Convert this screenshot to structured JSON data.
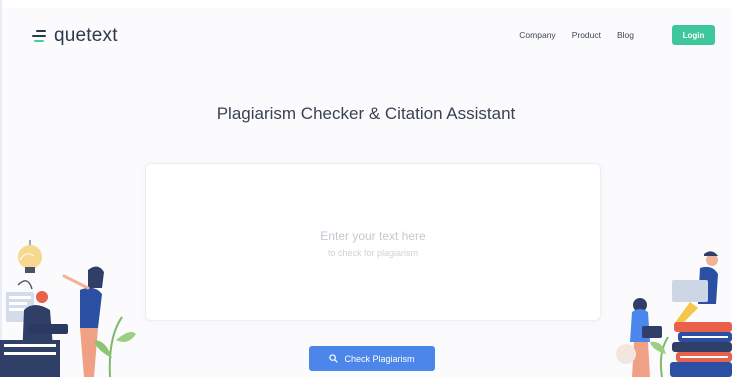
{
  "header": {
    "logo_text": "quetext",
    "nav": [
      "Company",
      "Product",
      "Blog"
    ],
    "login_label": "Login"
  },
  "main": {
    "title": "Plagiarism Checker & Citation Assistant",
    "placeholder_line1": "Enter your text here",
    "placeholder_line2": "to check for plagiarism",
    "check_button_label": "Check Plagiarism"
  },
  "colors": {
    "brand_green": "#3ec79a",
    "primary_blue": "#4d86ea",
    "text_dark": "#2d3a4c",
    "background": "#fbfbfd"
  },
  "icons": [
    "logo-mark-icon",
    "search-icon"
  ]
}
